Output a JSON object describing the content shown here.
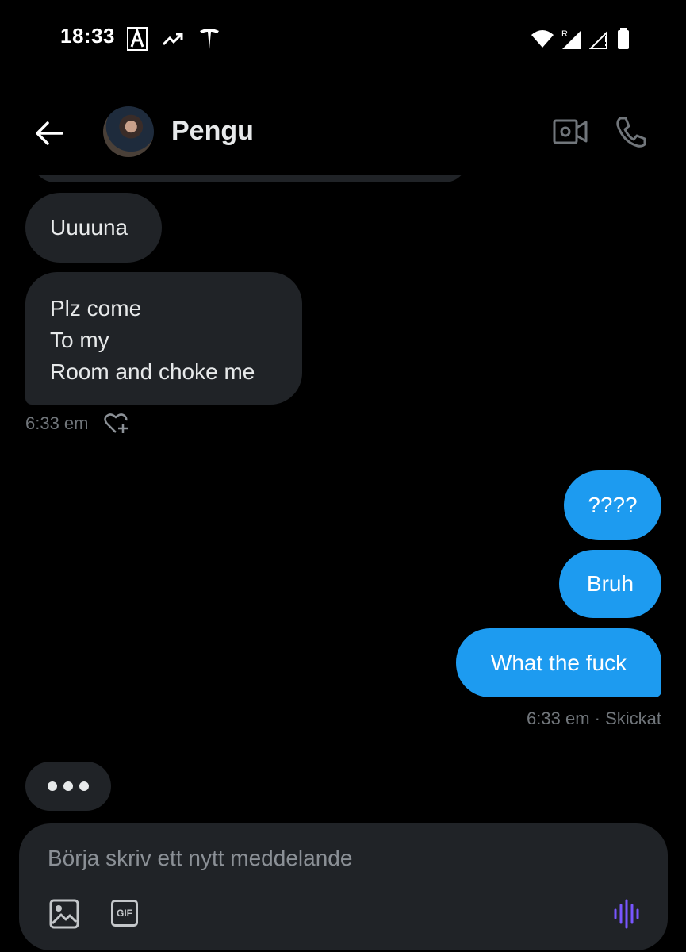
{
  "status_bar": {
    "time": "18:33",
    "left_icons": [
      "app-a-icon",
      "trending-icon",
      "tesla-icon"
    ],
    "right_icons": [
      "wifi-icon",
      "signal-r-icon",
      "signal-icon",
      "battery-icon"
    ]
  },
  "header": {
    "contact_name": "Pengu"
  },
  "messages": [
    {
      "direction": "incoming",
      "text": "Uuuuna"
    },
    {
      "direction": "incoming",
      "lines": [
        "Plz come",
        "To my",
        "Room and choke me"
      ]
    },
    {
      "direction": "outgoing",
      "text": "????"
    },
    {
      "direction": "outgoing",
      "text": "Bruh"
    },
    {
      "direction": "outgoing",
      "text": "What the fuck"
    }
  ],
  "incoming_meta": {
    "time": "6:33 em"
  },
  "outgoing_meta": {
    "text": "6:33 em · Skickat"
  },
  "composer": {
    "placeholder": "Börja skriv ett nytt meddelande",
    "value": "",
    "gif_label": "GIF"
  },
  "colors": {
    "background": "#000000",
    "incoming_bubble": "#202327",
    "outgoing_bubble": "#1d9bf0",
    "meta_text": "#71767b",
    "voice_accent": "#7856ff"
  }
}
